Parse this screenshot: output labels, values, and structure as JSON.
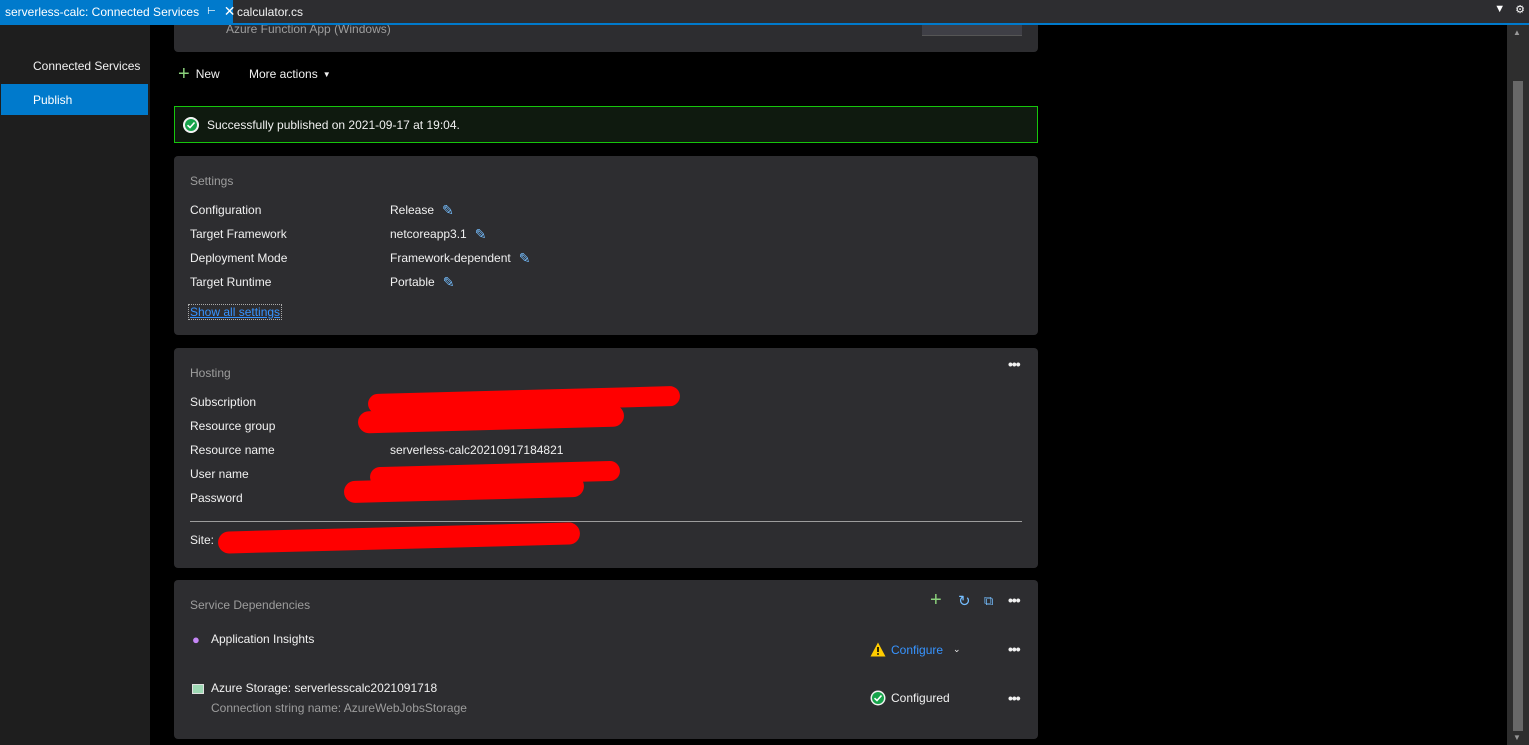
{
  "tabs": {
    "active": "serverless-calc: Connected Services",
    "second": "calculator.cs"
  },
  "sidebar": {
    "items": [
      {
        "label": "Connected Services"
      },
      {
        "label": "Publish"
      }
    ]
  },
  "profile": {
    "subtitle": "Azure Function App (Windows)"
  },
  "actions": {
    "new_label": "New",
    "more_label": "More actions"
  },
  "status": {
    "message": "Successfully published on 2021-09-17 at 19:04.",
    "color": "#16c60c"
  },
  "settings": {
    "title": "Settings",
    "rows": [
      {
        "label": "Configuration",
        "value": "Release"
      },
      {
        "label": "Target Framework",
        "value": "netcoreapp3.1"
      },
      {
        "label": "Deployment Mode",
        "value": "Framework-dependent"
      },
      {
        "label": "Target Runtime",
        "value": "Portable"
      }
    ],
    "show_all": "Show all settings"
  },
  "hosting": {
    "title": "Hosting",
    "rows": [
      {
        "label": "Subscription",
        "value": ""
      },
      {
        "label": "Resource group",
        "value": ""
      },
      {
        "label": "Resource name",
        "value": "serverless-calc20210917184821"
      },
      {
        "label": "User name",
        "value": ""
      },
      {
        "label": "Password",
        "value": ""
      }
    ],
    "site_label": "Site:"
  },
  "dependencies": {
    "title": "Service Dependencies",
    "items": [
      {
        "name": "Application Insights",
        "status": "Configure",
        "status_icon": "warning-icon"
      },
      {
        "name": "Azure Storage: serverlesscalc2021091718",
        "sub": "Connection string name: AzureWebJobsStorage",
        "status": "Configured",
        "status_icon": "check-circle-icon"
      }
    ]
  },
  "colors": {
    "accent": "#007acc",
    "link": "#3794ff",
    "redaction": "#ff0000",
    "warning": "#ffcc00",
    "success": "#16c60c"
  }
}
